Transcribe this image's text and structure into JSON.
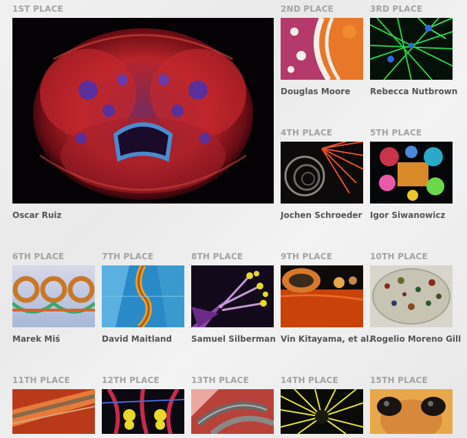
{
  "gallery": {
    "entries": [
      {
        "place": "1ST PLACE",
        "name": "Oscar Ruiz",
        "subject": "zebrafish embryo face"
      },
      {
        "place": "2ND PLACE",
        "name": "Douglas Moore",
        "subject": "fossil agate"
      },
      {
        "place": "3RD PLACE",
        "name": "Rebecca Nutbrown",
        "subject": "green cytoskeleton"
      },
      {
        "place": "4TH PLACE",
        "name": "Jochen Schroeder",
        "subject": "spiral with orange fibers"
      },
      {
        "place": "5TH PLACE",
        "name": "Igor Siwanowicz",
        "subject": "colorful water beetle leg"
      },
      {
        "place": "6TH PLACE",
        "name": "Marek Miś",
        "subject": "iridescent microstructure"
      },
      {
        "place": "7TH PLACE",
        "name": "David Maitland",
        "subject": "blue insect wing"
      },
      {
        "place": "8TH PLACE",
        "name": "Samuel Silberman",
        "subject": "purple flower stamens"
      },
      {
        "place": "9TH PLACE",
        "name": "Vin Kitayama, et al.",
        "subject": "orange textured surface"
      },
      {
        "place": "10TH PLACE",
        "name": "Rogelio Moreno Gill",
        "subject": "protozoan cell"
      },
      {
        "place": "11TH PLACE",
        "name": "",
        "subject": "red striped tissue"
      },
      {
        "place": "12TH PLACE",
        "name": "",
        "subject": "neurons with yellow marks"
      },
      {
        "place": "13TH PLACE",
        "name": "",
        "subject": "grey hooks"
      },
      {
        "place": "14TH PLACE",
        "name": "",
        "subject": "yellow radial spikes"
      },
      {
        "place": "15TH PLACE",
        "name": "",
        "subject": "insect eye close-up"
      }
    ]
  }
}
